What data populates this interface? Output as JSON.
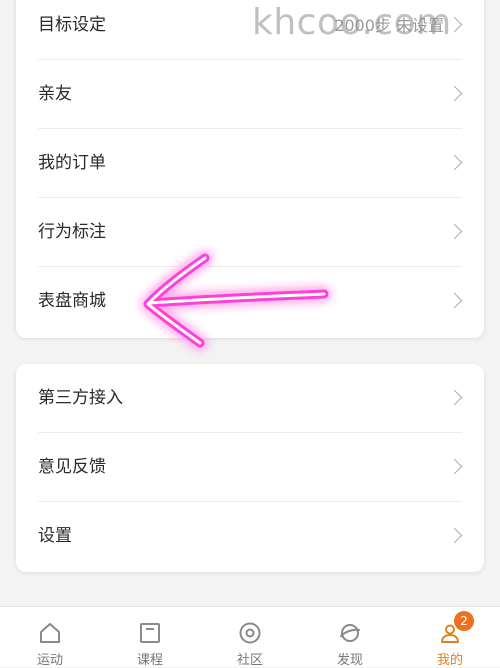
{
  "settings_card": {
    "rows": [
      {
        "label": "目标设定",
        "value": "2000步  未设置"
      },
      {
        "label": "亲友"
      },
      {
        "label": "我的订单"
      },
      {
        "label": "行为标注"
      },
      {
        "label": "表盘商城"
      }
    ]
  },
  "more_card": {
    "rows": [
      {
        "label": "第三方接入"
      },
      {
        "label": "意见反馈"
      },
      {
        "label": "设置"
      }
    ]
  },
  "watermark": "khcoo.com",
  "annotation": {
    "color": "#ff4fe0",
    "target": "表盘商城"
  },
  "tabbar": {
    "accent": "#e2801f",
    "tabs": [
      {
        "label": "运动",
        "icon": "home-icon"
      },
      {
        "label": "课程",
        "icon": "course-icon"
      },
      {
        "label": "社区",
        "icon": "community-icon"
      },
      {
        "label": "发现",
        "icon": "discover-icon"
      },
      {
        "label": "我的",
        "icon": "profile-icon",
        "badge": "2",
        "active": true
      }
    ]
  }
}
